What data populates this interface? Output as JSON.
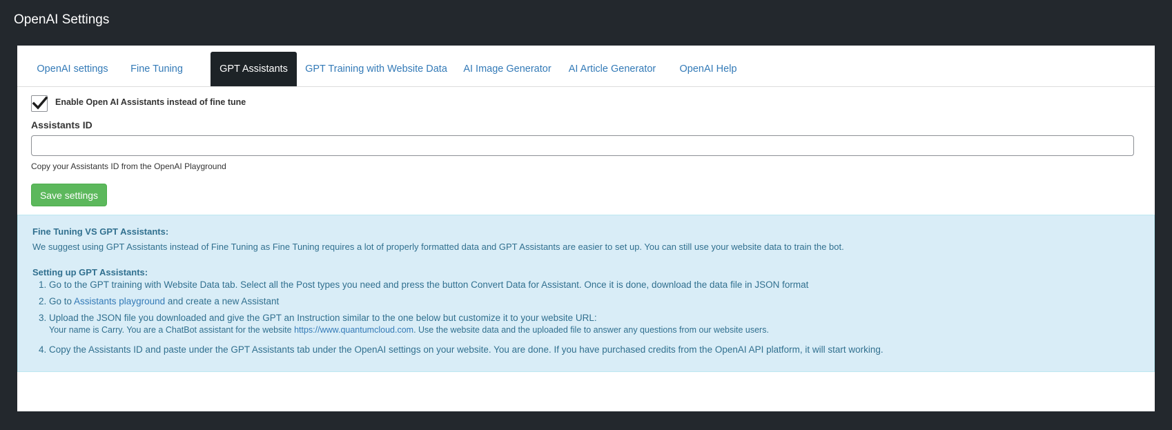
{
  "header": {
    "title": "OpenAI Settings"
  },
  "tabs": [
    {
      "label": "OpenAI settings",
      "active": false
    },
    {
      "label": "Fine Tuning",
      "active": false
    },
    {
      "label": "GPT Assistants",
      "active": true
    },
    {
      "label": "GPT Training with Website Data",
      "active": false
    },
    {
      "label": "AI Image Generator",
      "active": false
    },
    {
      "label": "AI Article Generator",
      "active": false
    },
    {
      "label": "OpenAI Help",
      "active": false
    }
  ],
  "form": {
    "enable_checkbox": {
      "label": "Enable Open AI Assistants instead of fine tune",
      "checked": true,
      "icon": "checkmark-icon"
    },
    "assistants_id": {
      "label": "Assistants ID",
      "value": "",
      "placeholder": ""
    },
    "help_text": "Copy your Assistants ID from the OpenAI Playground",
    "save_label": "Save settings"
  },
  "info": {
    "heading1": "Fine Tuning VS GPT Assistants:",
    "paragraph1": "We suggest using GPT Assistants instead of Fine Tuning as Fine Tuning requires a lot of properly formatted data and GPT Assistants are easier to set up. You can still use your website data to train the bot.",
    "heading2": "Setting up GPT Assistants:",
    "steps": [
      {
        "num": "1.",
        "text": "Go to the GPT training with Website Data tab. Select all the Post types you need and press the button Convert Data for Assistant. Once it is done, download the data file in JSON format"
      },
      {
        "num": "2.",
        "before": "Go to ",
        "link": "Assistants playground",
        "after": " and create a new Assistant"
      },
      {
        "num": "3.",
        "text": "Upload the JSON file you downloaded and give the GPT an Instruction similar to the one below but customize it to your website URL:"
      },
      {
        "num": "4.",
        "text": "Copy the Assistants ID and paste under the GPT Assistants tab under the OpenAI settings on your website. You are done. If you have purchased credits from the OpenAI API platform, it will start working."
      }
    ],
    "instruction": {
      "before": "Your name is Carry. You are a ChatBot assistant for the website ",
      "link": "https://www.quantumcloud.com",
      "after": ". Use the website data and the uploaded file to answer any questions from our website users."
    }
  },
  "colors": {
    "background": "#23282d",
    "active_tab": "#1d2327",
    "link": "#337ab7",
    "save_button": "#5cb85c",
    "info_bg": "#d9edf7",
    "info_text": "#31708f"
  }
}
